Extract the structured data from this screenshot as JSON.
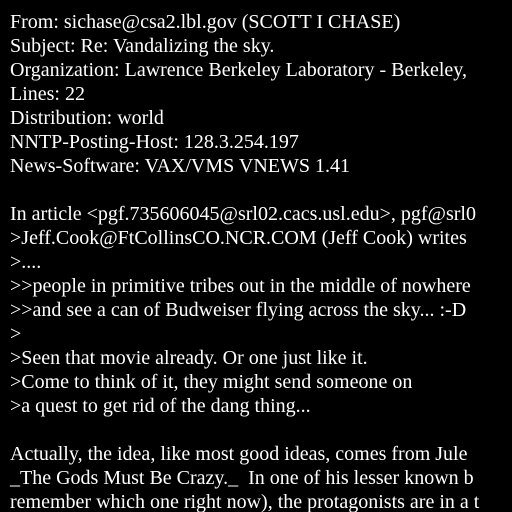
{
  "headers": {
    "from": "From: sichase@csa2.lbl.gov (SCOTT I CHASE)",
    "subject": "Subject: Re: Vandalizing the sky.",
    "organization": "Organization: Lawrence Berkeley Laboratory - Berkeley,",
    "lines": "Lines: 22",
    "distribution": "Distribution: world",
    "nntp_posting_host": "NNTP-Posting-Host: 128.3.254.197",
    "news_software": "News-Software: VAX/VMS VNEWS 1.41"
  },
  "quote": {
    "attribution": "In article <pgf.735606045@srl02.cacs.usl.edu>, pgf@srl0",
    "lines": [
      ">Jeff.Cook@FtCollinsCO.NCR.COM (Jeff Cook) writes",
      ">....",
      ">>people in primitive tribes out in the middle of nowhere",
      ">>and see a can of Budweiser flying across the sky... :-D",
      ">",
      ">Seen that movie already. Or one just like it.",
      ">Come to think of it, they might send someone on",
      ">a quest to get rid of the dang thing..."
    ]
  },
  "body": {
    "lines": [
      "Actually, the idea, like most good ideas, comes from Jule",
      "_The Gods Must Be Crazy._  In one of his lesser known b",
      "remember which one right now), the protagonists are in a t"
    ]
  }
}
